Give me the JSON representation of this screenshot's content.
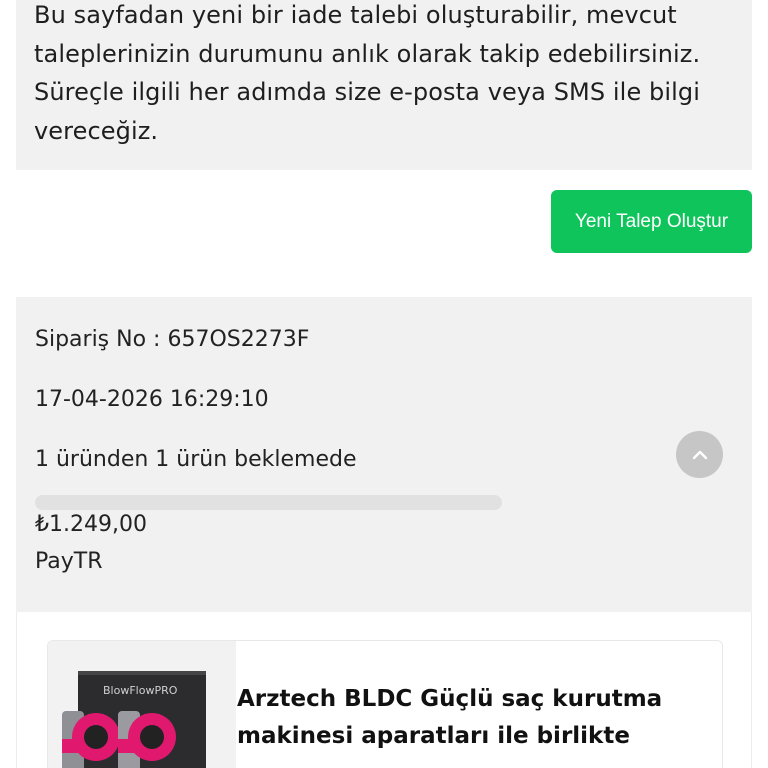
{
  "info": {
    "text": "Bu sayfadan yeni bir iade talebi oluşturabilir, mevcut taleplerinizin durumunu anlık olarak takip edebilirsiniz. Süreçle ilgili her adımda size e-posta veya SMS ile bilgi vereceğiz."
  },
  "actions": {
    "new_request_label": "Yeni Talep Oluştur",
    "new_request_color": "#10c45c"
  },
  "order": {
    "order_no": "Sipariş No : 657OS2273F",
    "date": "17-04-2026 16:29:10",
    "status": "1 üründen 1 ürün beklemede",
    "progress_fraction": 0,
    "amount": "₺1.249,00",
    "payment_method": "PayTR",
    "toggle_icon": "chevron-up-icon"
  },
  "product": {
    "title": "Arztech BLDC Güçlü saç kurutma makinesi aparatları ile birlikte",
    "image_brand_text": "BlowFlowPRO"
  }
}
